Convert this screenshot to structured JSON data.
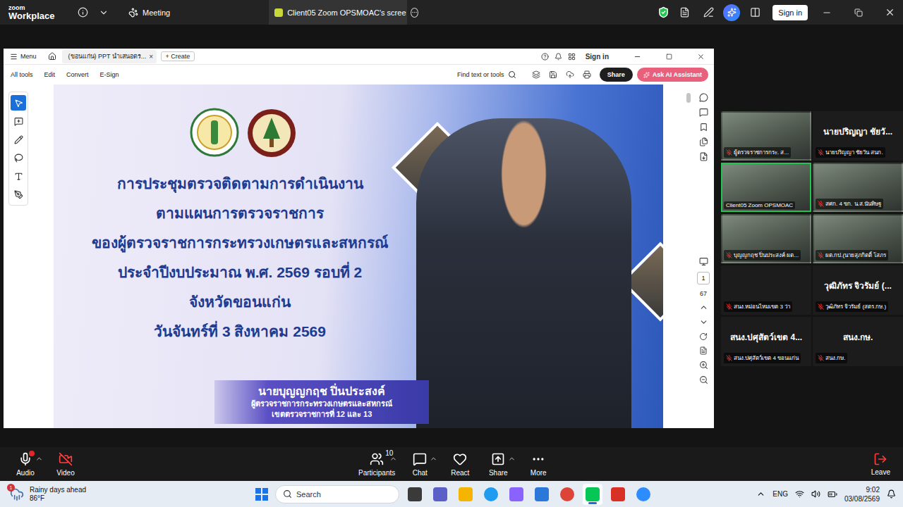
{
  "zoom_bar": {
    "brand_top": "zoom",
    "brand_bottom": "Workplace",
    "meeting_label": "Meeting",
    "share_tab": "Client05 Zoom OPSMOAC's scree",
    "sign_in": "Sign in"
  },
  "pdf_viewer": {
    "menu": "Menu",
    "tab_title": "(ขอนแก่น) PPT นำเสนอตร...",
    "tab_close": "×",
    "create": "+ Create",
    "sign_in": "Sign in",
    "toolbar": [
      "All tools",
      "Edit",
      "Convert",
      "E-Sign"
    ],
    "find": "Find text or tools",
    "share": "Share",
    "ai": "Ask AI Assistant",
    "page": "1",
    "page_count": "67",
    "tools": [
      {
        "selected": true
      },
      {
        "selected": false
      },
      {
        "selected": false
      },
      {
        "selected": false
      },
      {
        "selected": false
      },
      {
        "selected": false
      }
    ]
  },
  "slide": {
    "title_lines": [
      "การประชุมตรวจติดตามการดำเนินงาน",
      "ตามแผนการตรวจราชการ",
      "ของผู้ตรวจราชการกระทรวงเกษตรและสหกรณ์",
      "ประจำปีงบประมาณ พ.ศ. 2569 รอบที่ 2",
      "จังหวัดขอนแก่น",
      "วันจันทร์ที่ 3 สิงหาคม 2569"
    ],
    "presenter": "นายบุญญกฤช ปิ่นประสงค์",
    "presenter_role": "ผู้ตรวจราชการกระทรวงเกษตรและสหกรณ์",
    "presenter_zone": "เขตตรวจราชการที่ 12 และ 13"
  },
  "participants": [
    {
      "kind": "video",
      "label": "ผู้ตรวจราชการกระ. ส...",
      "muted": true,
      "active": false
    },
    {
      "kind": "name",
      "display": "นายปริญญา ชัยวั...",
      "label": "นายปริญญา ชัยวัน สนก.",
      "muted": true,
      "active": false
    },
    {
      "kind": "video",
      "label": "Client05 Zoom OPSMOAC",
      "muted": false,
      "active": true
    },
    {
      "kind": "video",
      "label": "สศก. 4 ขก. น.ส.นันทิษฐ",
      "muted": true,
      "active": false
    },
    {
      "kind": "video",
      "label": "บุญญกฤช ปิ่นประสงค์ ผต...",
      "muted": true,
      "active": false
    },
    {
      "kind": "video",
      "label": "ผต.กป.(นายสุภกิตติ์ โสภร",
      "muted": true,
      "active": false
    },
    {
      "kind": "blank",
      "label": "สนง.หม่อนไหมเขต 3 ว่า",
      "muted": true,
      "active": false
    },
    {
      "kind": "name",
      "display": "วุฒิภัทร จิวรัมย์ (...",
      "label": "วุฒิภัทร จิวรัมย์ (สตร.กษ.)",
      "muted": true,
      "active": false
    },
    {
      "kind": "name",
      "display": "สนง.ปศุสัตว์เขต 4...",
      "label": "สนง.ปศุสัตว์เขต 4 ขอนแก่น",
      "muted": true,
      "active": false
    },
    {
      "kind": "name",
      "display": "สนง.กษ.",
      "label": "สนง.กษ.",
      "muted": true,
      "active": false
    }
  ],
  "controls": [
    {
      "label": "Audio",
      "caret": true,
      "alert": true,
      "off": false
    },
    {
      "label": "Video",
      "caret": false,
      "alert": false,
      "off": true
    },
    {
      "label": "Participants",
      "count": "10",
      "caret": true,
      "alert": false,
      "off": false
    },
    {
      "label": "Chat",
      "caret": true,
      "alert": false,
      "off": false
    },
    {
      "label": "React",
      "caret": false,
      "alert": false,
      "off": false
    },
    {
      "label": "Share",
      "caret": true,
      "alert": false,
      "off": false
    },
    {
      "label": "More",
      "caret": false,
      "alert": false,
      "off": false
    }
  ],
  "leave": "Leave",
  "taskbar": {
    "weather_title": "Rainy days ahead",
    "weather_temp": "86°F",
    "weather_badge": "1",
    "search": "Search",
    "apps": [
      {
        "selected": false
      },
      {
        "selected": false
      },
      {
        "selected": false
      },
      {
        "selected": false
      },
      {
        "selected": false
      },
      {
        "selected": false
      },
      {
        "selected": false
      },
      {
        "selected": true
      },
      {
        "selected": false
      },
      {
        "selected": false
      }
    ],
    "lang": "ENG",
    "time": "9:02",
    "date": "03/08/2569"
  }
}
